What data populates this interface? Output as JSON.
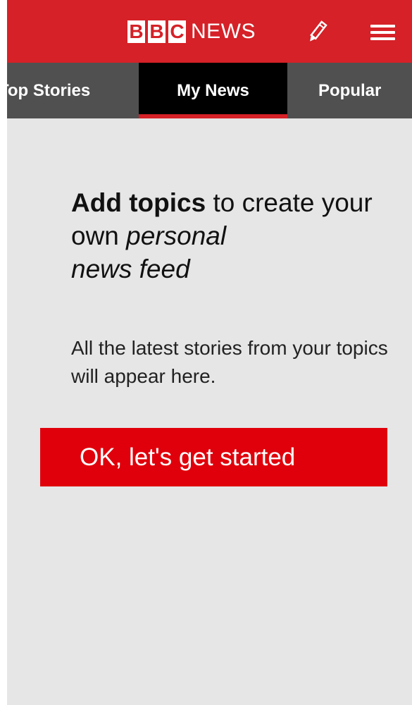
{
  "header": {
    "logo_letters": [
      "B",
      "B",
      "C"
    ],
    "logo_word": "NEWS",
    "brand_color": "#d52127",
    "edit_icon": "pencil-icon",
    "menu_icon": "hamburger-menu-icon"
  },
  "tabs": {
    "items": [
      {
        "label": "Top Stories",
        "selected": false
      },
      {
        "label": "My News",
        "selected": true
      },
      {
        "label": "Popular",
        "selected": false
      }
    ],
    "active_color": "#000000",
    "bar_color": "#505050",
    "indicator_color": "#d52127"
  },
  "main": {
    "headline": {
      "bold": "Add topics",
      "normal": " to create your own ",
      "italic_1": "personal",
      "italic_2": "news feed"
    },
    "subtext": "All the latest stories from your topics will appear here.",
    "cta_label": "OK, let's get started",
    "cta_color": "#e0000b",
    "background": "#e6e6e6"
  }
}
